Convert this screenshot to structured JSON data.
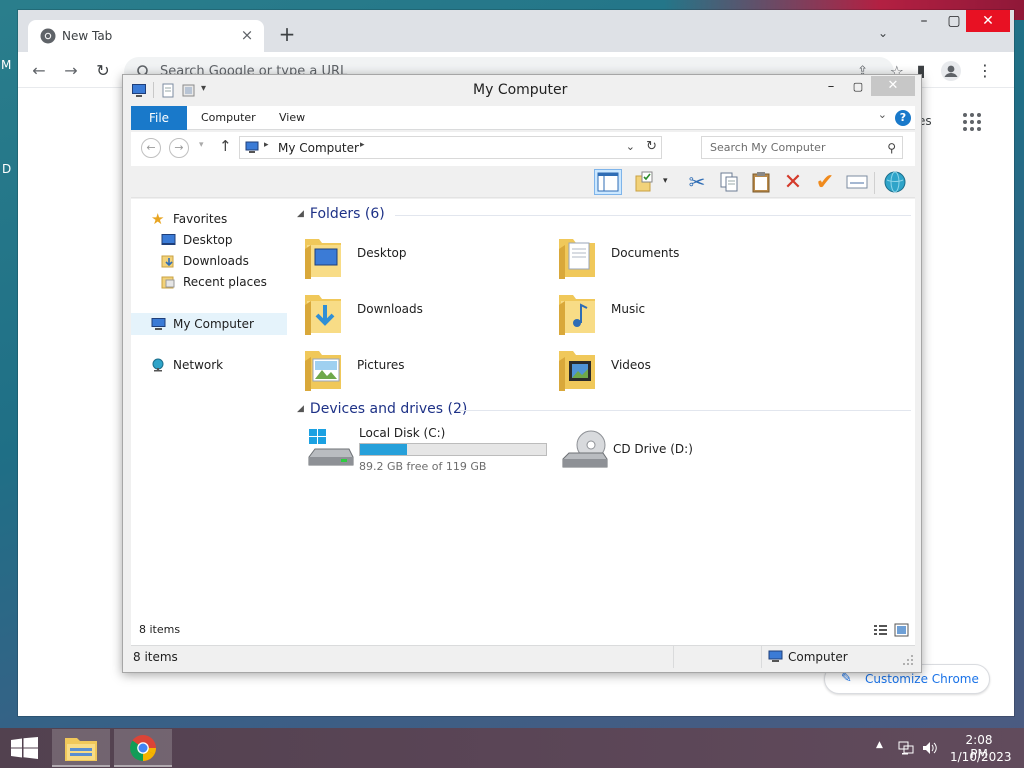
{
  "desktop": {
    "edge_letters": [
      "M",
      "D"
    ]
  },
  "chrome": {
    "tab_title": "New Tab",
    "tab_close": "×",
    "new_tab": "+",
    "omnibox_placeholder": "Search Google or type a URL",
    "apps_text": "es",
    "customize_label": "Customize Chrome",
    "window_controls": {
      "minimize": "–",
      "maximize": "▢",
      "close": "✕"
    }
  },
  "explorer": {
    "title": "My Computer",
    "window_controls": {
      "minimize": "–",
      "maximize": "▢",
      "close": "✕"
    },
    "ribbon_tabs": [
      "File",
      "Computer",
      "View"
    ],
    "help": "?",
    "address_crumb": "My Computer",
    "search_placeholder": "Search My Computer",
    "nav": {
      "favorites": "Favorites",
      "desktop": "Desktop",
      "downloads": "Downloads",
      "recent": "Recent places",
      "my_computer": "My Computer",
      "network": "Network"
    },
    "folders_header": "Folders (6)",
    "folders": [
      "Desktop",
      "Documents",
      "Downloads",
      "Music",
      "Pictures",
      "Videos"
    ],
    "drives_header": "Devices and drives (2)",
    "drives": [
      {
        "label": "Local Disk (C:)",
        "free_text": "89.2 GB free of 119 GB",
        "used_fraction": 0.25
      },
      {
        "label": "CD Drive (D:)"
      }
    ],
    "content_item_count": "8 items",
    "status_left": "8 items",
    "status_right": "Computer"
  },
  "taskbar": {
    "time": "2:08 PM",
    "date": "1/10/2023",
    "tray_arrow": "▲"
  },
  "colors": {
    "accent": "#1979ca",
    "progress": "#26a0da",
    "chrome_link": "#1a73e8",
    "group_header": "#1e3287"
  }
}
